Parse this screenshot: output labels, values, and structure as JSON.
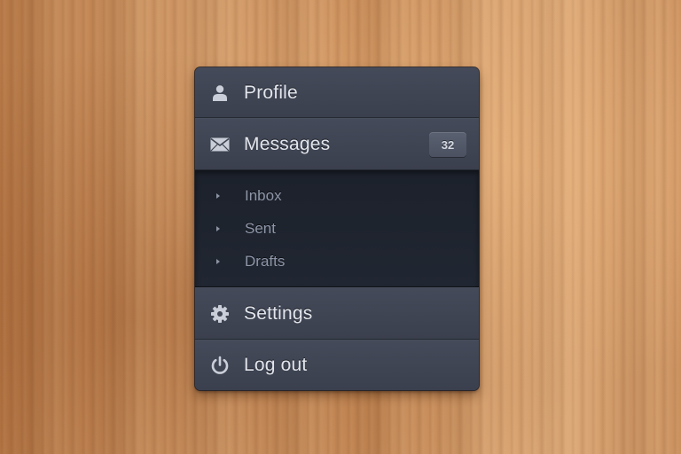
{
  "menu": {
    "profile": {
      "label": "Profile",
      "icon": "user-icon"
    },
    "messages": {
      "label": "Messages",
      "icon": "envelope-icon",
      "badge": "32",
      "submenu": [
        {
          "label": "Inbox",
          "icon": "caret-right-icon"
        },
        {
          "label": "Sent",
          "icon": "caret-right-icon"
        },
        {
          "label": "Drafts",
          "icon": "caret-right-icon"
        }
      ]
    },
    "settings": {
      "label": "Settings",
      "icon": "gear-icon"
    },
    "logout": {
      "label": "Log out",
      "icon": "power-icon"
    }
  },
  "colors": {
    "menu_background": "#3a3f4d",
    "submenu_background": "#1f2430",
    "label_text": "#e2e5ec",
    "submenu_text": "#8e96a8",
    "badge_background": "#545b6a",
    "wood_background": "#c98e5c"
  }
}
